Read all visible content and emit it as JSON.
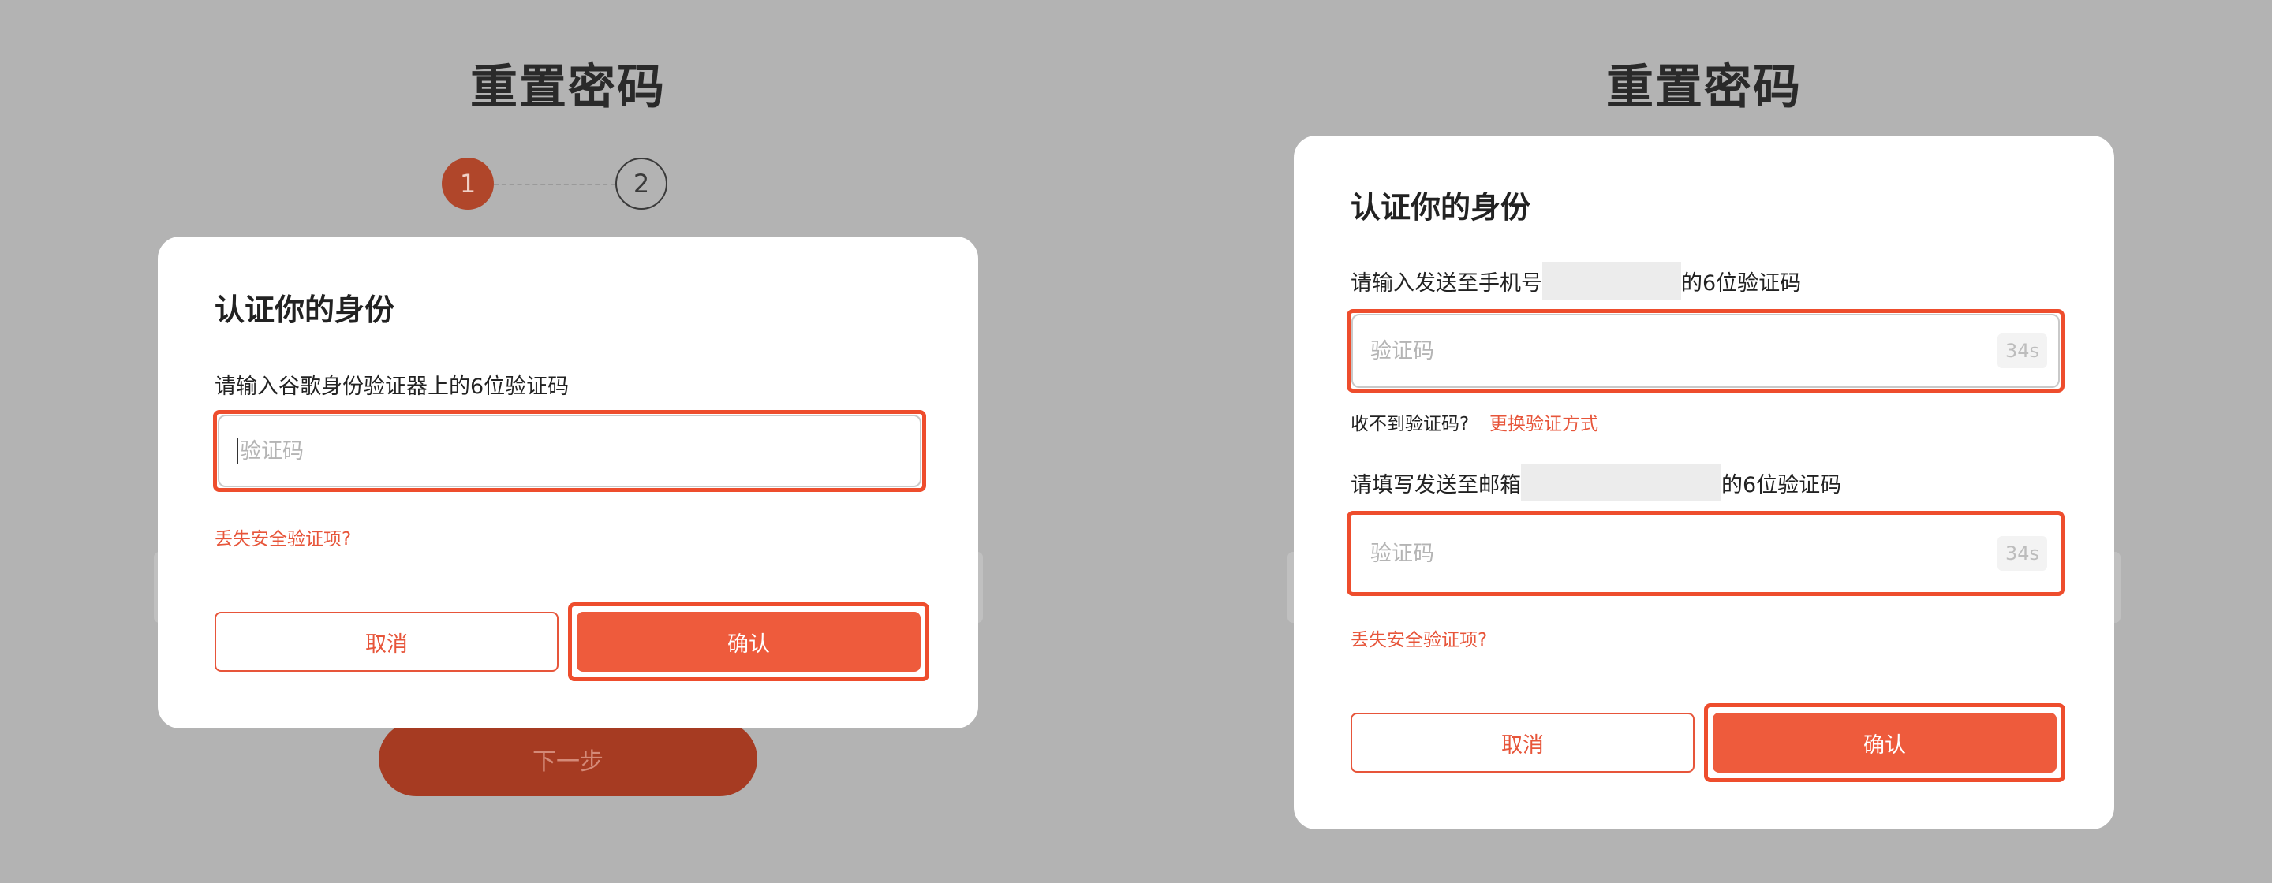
{
  "page_title": "重置密码",
  "stepper": {
    "step1": "1",
    "step2": "2"
  },
  "next_button": "下一步",
  "modal_title": "认证你的身份",
  "left_dialog": {
    "prompt": "请输入谷歌身份验证器上的6位验证码",
    "code_placeholder": "验证码",
    "lost_security_link": "丢失安全验证项?",
    "cancel": "取消",
    "confirm": "确认"
  },
  "right_dialog": {
    "phone_prompt_prefix": "请输入发送至手机号",
    "phone_prompt_suffix": "的6位验证码",
    "phone_code_placeholder": "验证码",
    "phone_timer": "34s",
    "not_received": "收不到验证码?",
    "switch_method": "更换验证方式",
    "email_prompt_prefix": "请填写发送至邮箱",
    "email_prompt_suffix": "的6位验证码",
    "email_code_placeholder": "验证码",
    "email_timer": "34s",
    "lost_security_link": "丢失安全验证项?",
    "cancel": "取消",
    "confirm": "确认"
  },
  "colors": {
    "accent": "#ee5b3c",
    "highlight": "#ee4d2d",
    "overlay": "#b3b3b3",
    "step_active": "#b0462a"
  }
}
